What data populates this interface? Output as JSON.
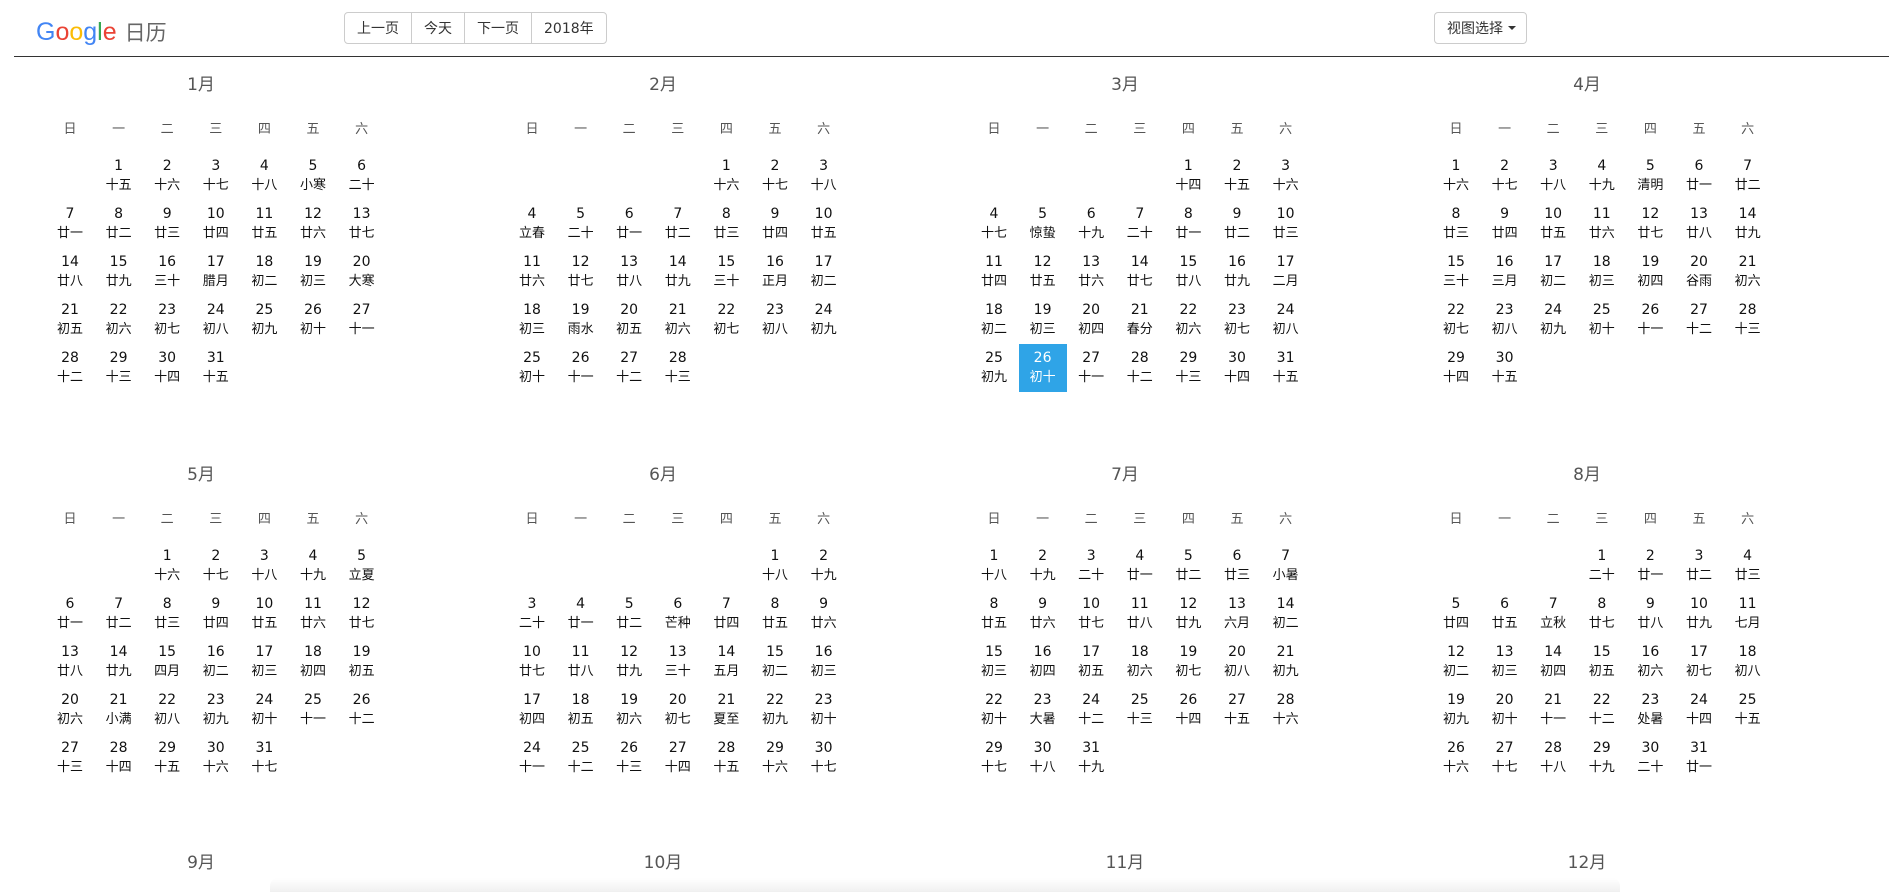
{
  "app": {
    "logo_letters": [
      {
        "ch": "G",
        "color": "#4285f4"
      },
      {
        "ch": "o",
        "color": "#ea4335"
      },
      {
        "ch": "o",
        "color": "#fbbc05"
      },
      {
        "ch": "g",
        "color": "#4285f4"
      },
      {
        "ch": "l",
        "color": "#34a853"
      },
      {
        "ch": "e",
        "color": "#ea4335"
      }
    ],
    "logo_suffix": "日历"
  },
  "toolbar": {
    "prev_label": "上一页",
    "today_label": "今天",
    "next_label": "下一页",
    "year_label": "2018年"
  },
  "view_select_label": "视图选择",
  "weekday_headers": [
    "日",
    "一",
    "二",
    "三",
    "四",
    "五",
    "六"
  ],
  "today_color": "#2fa4e7",
  "months": [
    {
      "title": "1月",
      "start": 1,
      "lunar": [
        "十五",
        "十六",
        "十七",
        "十八",
        "小寒",
        "二十",
        "廿一",
        "廿二",
        "廿三",
        "廿四",
        "廿五",
        "廿六",
        "廿七",
        "廿八",
        "廿九",
        "三十",
        "腊月",
        "初二",
        "初三",
        "大寒",
        "初五",
        "初六",
        "初七",
        "初八",
        "初九",
        "初十",
        "十一",
        "十二",
        "十三",
        "十四",
        "十五"
      ]
    },
    {
      "title": "2月",
      "start": 4,
      "lunar": [
        "十六",
        "十七",
        "十八",
        "立春",
        "二十",
        "廿一",
        "廿二",
        "廿三",
        "廿四",
        "廿五",
        "廿六",
        "廿七",
        "廿八",
        "廿九",
        "三十",
        "正月",
        "初二",
        "初三",
        "雨水",
        "初五",
        "初六",
        "初七",
        "初八",
        "初九",
        "初十",
        "十一",
        "十二",
        "十三"
      ]
    },
    {
      "title": "3月",
      "start": 4,
      "lunar": [
        "十四",
        "十五",
        "十六",
        "十七",
        "惊蛰",
        "十九",
        "二十",
        "廿一",
        "廿二",
        "廿三",
        "廿四",
        "廿五",
        "廿六",
        "廿七",
        "廿八",
        "廿九",
        "二月",
        "初二",
        "初三",
        "初四",
        "春分",
        "初六",
        "初七",
        "初八",
        "初九",
        "初十",
        "十一",
        "十二",
        "十三",
        "十四",
        "十五"
      ]
    },
    {
      "title": "4月",
      "start": 0,
      "lunar": [
        "十六",
        "十七",
        "十八",
        "十九",
        "清明",
        "廿一",
        "廿二",
        "廿三",
        "廿四",
        "廿五",
        "廿六",
        "廿七",
        "廿八",
        "廿九",
        "三十",
        "三月",
        "初二",
        "初三",
        "初四",
        "谷雨",
        "初六",
        "初七",
        "初八",
        "初九",
        "初十",
        "十一",
        "十二",
        "十三",
        "十四",
        "十五"
      ]
    },
    {
      "title": "5月",
      "start": 2,
      "lunar": [
        "十六",
        "十七",
        "十八",
        "十九",
        "立夏",
        "廿一",
        "廿二",
        "廿三",
        "廿四",
        "廿五",
        "廿六",
        "廿七",
        "廿八",
        "廿九",
        "四月",
        "初二",
        "初三",
        "初四",
        "初五",
        "初六",
        "小满",
        "初八",
        "初九",
        "初十",
        "十一",
        "十二",
        "十三",
        "十四",
        "十五",
        "十六",
        "十七"
      ]
    },
    {
      "title": "6月",
      "start": 5,
      "lunar": [
        "十八",
        "十九",
        "二十",
        "廿一",
        "廿二",
        "芒种",
        "廿四",
        "廿五",
        "廿六",
        "廿七",
        "廿八",
        "廿九",
        "三十",
        "五月",
        "初二",
        "初三",
        "初四",
        "初五",
        "初六",
        "初七",
        "夏至",
        "初九",
        "初十",
        "十一",
        "十二",
        "十三",
        "十四",
        "十五",
        "十六",
        "十七"
      ]
    },
    {
      "title": "7月",
      "start": 0,
      "lunar": [
        "十八",
        "十九",
        "二十",
        "廿一",
        "廿二",
        "廿三",
        "小暑",
        "廿五",
        "廿六",
        "廿七",
        "廿八",
        "廿九",
        "六月",
        "初二",
        "初三",
        "初四",
        "初五",
        "初六",
        "初七",
        "初八",
        "初九",
        "初十",
        "大暑",
        "十二",
        "十三",
        "十四",
        "十五",
        "十六",
        "十七",
        "十八",
        "十九"
      ]
    },
    {
      "title": "8月",
      "start": 3,
      "lunar": [
        "二十",
        "廿一",
        "廿二",
        "廿三",
        "廿四",
        "廿五",
        "立秋",
        "廿七",
        "廿八",
        "廿九",
        "七月",
        "初二",
        "初三",
        "初四",
        "初五",
        "初六",
        "初七",
        "初八",
        "初九",
        "初十",
        "十一",
        "十二",
        "处暑",
        "十四",
        "十五",
        "十六",
        "十七",
        "十八",
        "十九",
        "二十",
        "廿一"
      ]
    },
    {
      "title": "9月",
      "start": 0,
      "lunar": []
    },
    {
      "title": "10月",
      "start": 0,
      "lunar": []
    },
    {
      "title": "11月",
      "start": 0,
      "lunar": []
    },
    {
      "title": "12月",
      "start": 0,
      "lunar": []
    }
  ],
  "selected_day": {
    "month": 3,
    "day": 26
  }
}
